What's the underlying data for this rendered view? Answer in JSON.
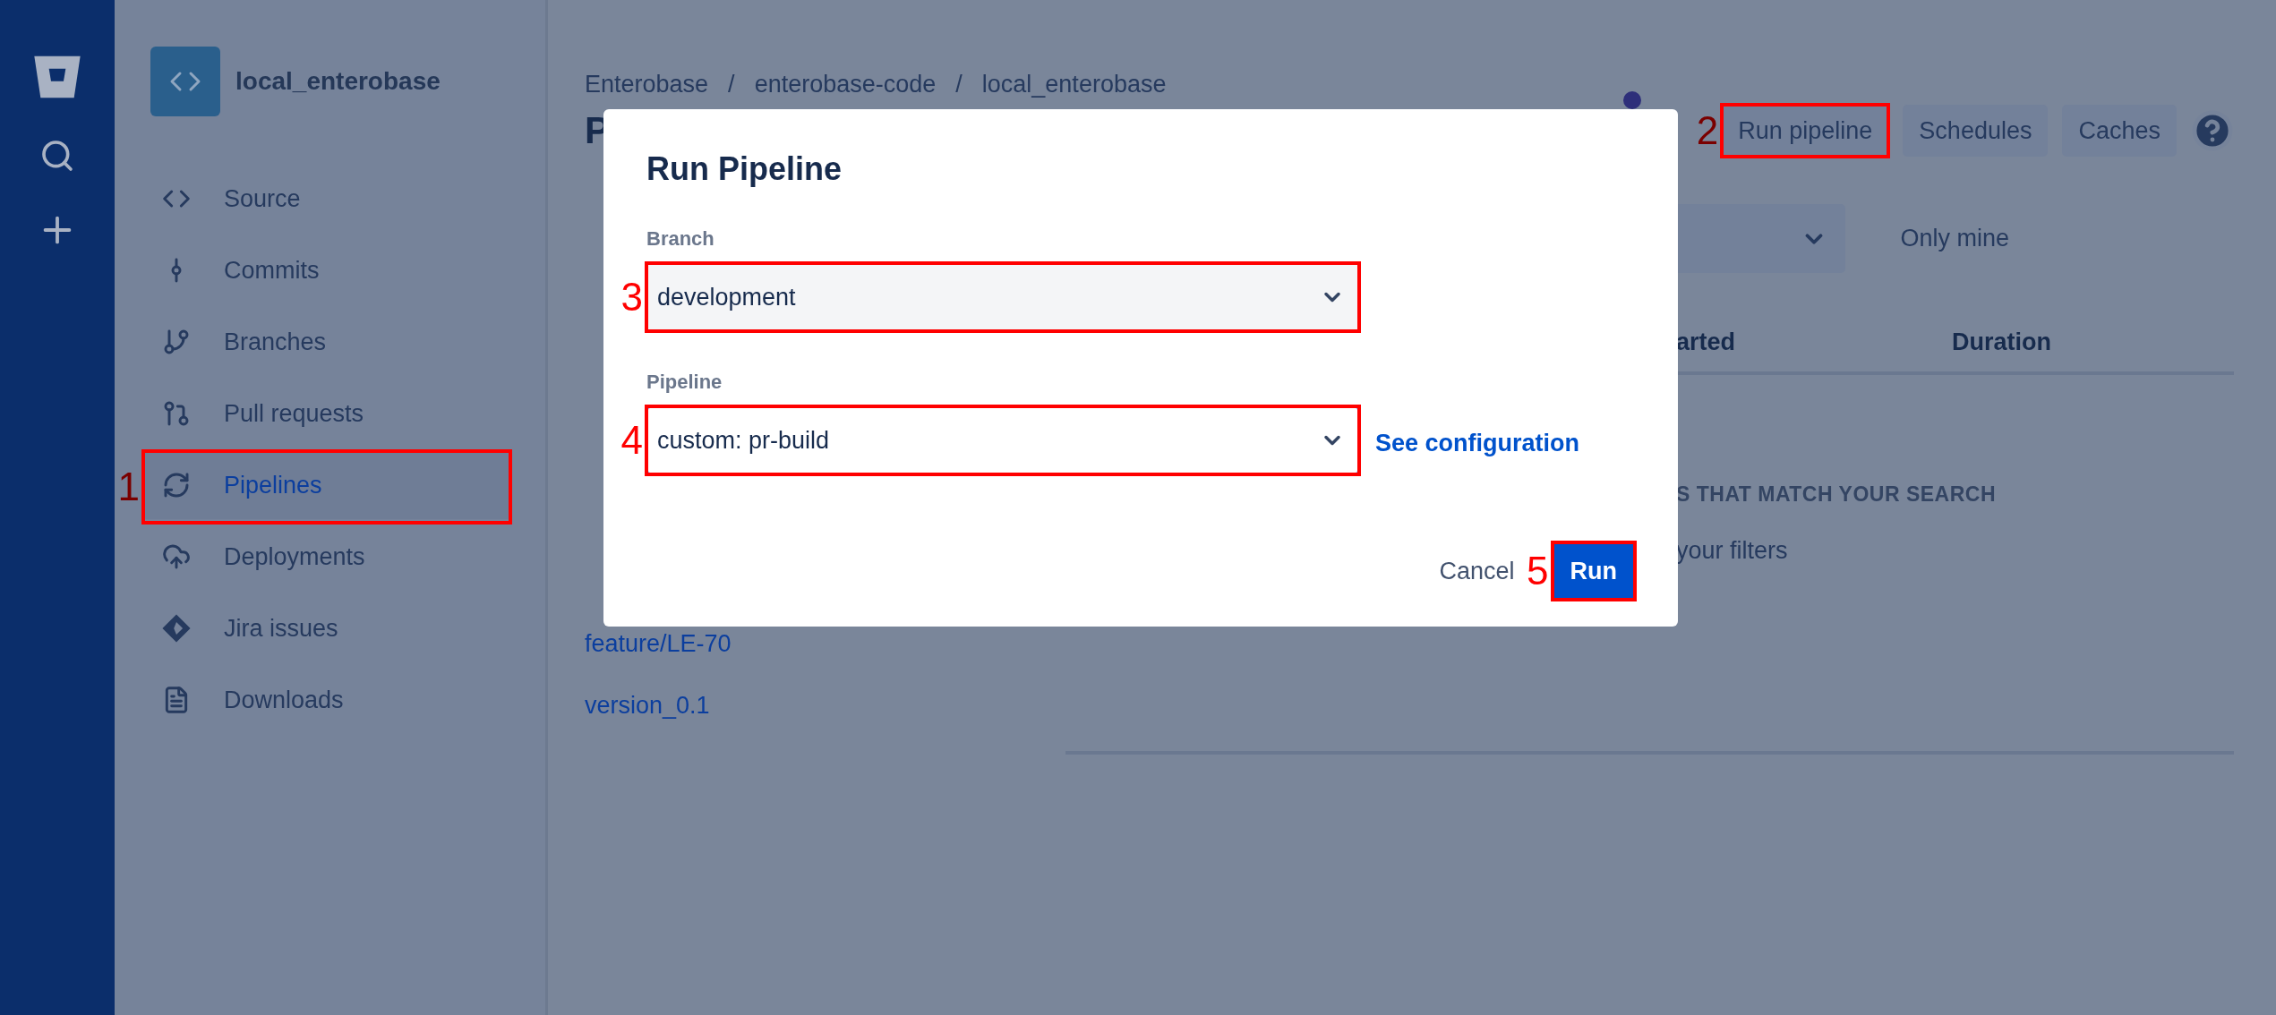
{
  "repository": {
    "name": "local_enterobase"
  },
  "sidebar": {
    "items": [
      {
        "kind": "source",
        "label": "Source",
        "selected": false
      },
      {
        "kind": "commits",
        "label": "Commits",
        "selected": false
      },
      {
        "kind": "branches",
        "label": "Branches",
        "selected": false
      },
      {
        "kind": "pulls",
        "label": "Pull requests",
        "selected": false
      },
      {
        "kind": "pipelines",
        "label": "Pipelines",
        "selected": true,
        "callout": "1"
      },
      {
        "kind": "deployments",
        "label": "Deployments",
        "selected": false
      },
      {
        "kind": "jira",
        "label": "Jira issues",
        "selected": false
      },
      {
        "kind": "downloads",
        "label": "Downloads",
        "selected": false
      }
    ]
  },
  "breadcrumb": {
    "separator": "/",
    "items": [
      "Enterobase",
      "enterobase-code",
      "local_enterobase"
    ]
  },
  "page_title": "P",
  "toolbar": {
    "buttons": [
      {
        "label": "Run pipeline",
        "callout": "2"
      },
      {
        "label": "Schedules"
      },
      {
        "label": "Caches"
      }
    ]
  },
  "filters": {
    "only_mine": "Only mine"
  },
  "table": {
    "columns": [
      "arted",
      "Duration"
    ]
  },
  "empty_state": {
    "heading": "S THAT MATCH YOUR SEARCH",
    "text": "your filters"
  },
  "branch_list": [
    "feature/LE-70",
    "version_0.1"
  ],
  "dialog": {
    "title": "Run Pipeline",
    "fields": [
      {
        "label": "Branch",
        "value": "development",
        "focused": false,
        "callout": "3"
      },
      {
        "label": "Pipeline",
        "value": "custom: pr-build",
        "focused": true,
        "callout": "4",
        "link": "See configuration"
      }
    ],
    "cancel": "Cancel",
    "submit": {
      "label": "Run",
      "callout": "5"
    }
  }
}
